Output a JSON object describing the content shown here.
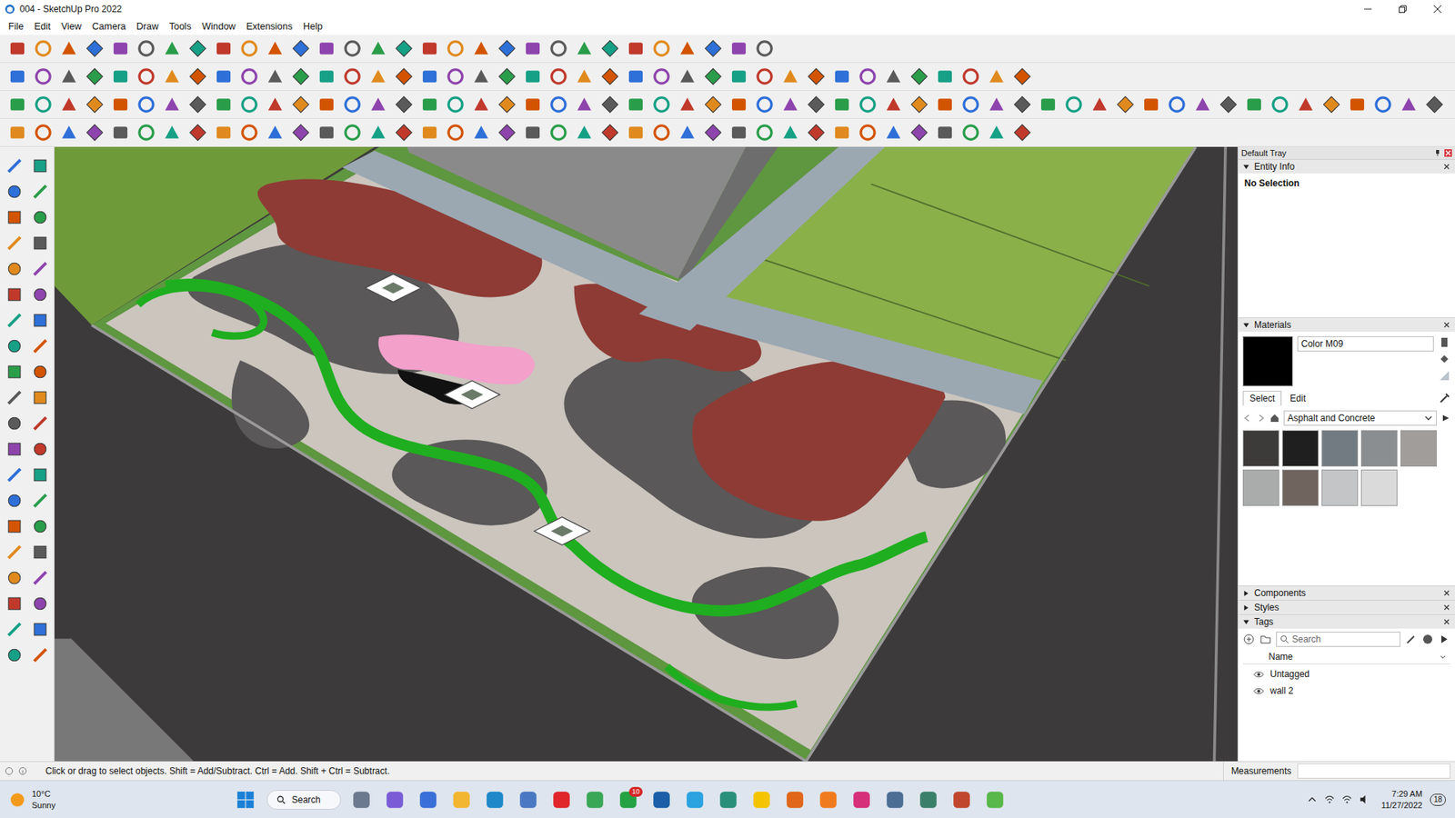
{
  "window": {
    "title": "004 - SketchUp Pro 2022"
  },
  "menu": [
    "File",
    "Edit",
    "View",
    "Camera",
    "Draw",
    "Tools",
    "Window",
    "Extensions",
    "Help"
  ],
  "tray": {
    "title": "Default Tray",
    "entity_info": {
      "title": "Entity Info",
      "expanded": true,
      "text": "No Selection"
    },
    "materials": {
      "title": "Materials",
      "expanded": true,
      "name": "Color M09",
      "color": "#000000",
      "tabs": [
        {
          "label": "Select",
          "selected": true
        },
        {
          "label": "Edit",
          "selected": false
        }
      ],
      "library": "Asphalt and Concrete",
      "swatches": [
        {
          "color": "#3d3a3a"
        },
        {
          "color": "#1f1f1f"
        },
        {
          "color": "#737b82"
        },
        {
          "color": "#8b8e90"
        },
        {
          "color": "#a19d9b"
        },
        {
          "color": "#a9acab"
        },
        {
          "color": "#6f655e"
        },
        {
          "color": "#c3c5c7"
        },
        {
          "color": "#dadada"
        }
      ]
    },
    "collapsed": [
      {
        "title": "Components",
        "expanded": false
      },
      {
        "title": "Styles",
        "expanded": false
      }
    ],
    "tags": {
      "title": "Tags",
      "expanded": true,
      "search_placeholder": "Search",
      "column": "Name",
      "items": [
        {
          "name": "Untagged",
          "visible": true
        },
        {
          "name": "wall 2",
          "visible": true
        }
      ]
    }
  },
  "status_bar": {
    "hint": "Click or drag to select objects. Shift = Add/Subtract. Ctrl = Add. Shift + Ctrl = Subtract.",
    "measurements_label": "Measurements",
    "measurements_value": ""
  },
  "taskbar": {
    "weather": {
      "temp": "10°C",
      "condition": "Sunny"
    },
    "search": "Search",
    "apps": [
      {
        "color": "#6b7a8f",
        "badge": ""
      },
      {
        "color": "#7b5cd6",
        "badge": ""
      },
      {
        "color": "#3a6fd8",
        "badge": ""
      },
      {
        "color": "#f2b632",
        "badge": ""
      },
      {
        "color": "#1e88c9",
        "badge": ""
      },
      {
        "color": "#4a78c2",
        "badge": ""
      },
      {
        "color": "#e0262b",
        "badge": ""
      },
      {
        "color": "#3aa757",
        "badge": ""
      },
      {
        "color": "#25a244",
        "badge": "10"
      },
      {
        "color": "#1c5fa8",
        "badge": ""
      },
      {
        "color": "#2aa3e0",
        "badge": ""
      },
      {
        "color": "#2a8f7a",
        "badge": ""
      },
      {
        "color": "#f5c400",
        "badge": ""
      },
      {
        "color": "#e0661a",
        "badge": ""
      },
      {
        "color": "#f07b1e",
        "badge": ""
      },
      {
        "color": "#d6307a",
        "badge": ""
      },
      {
        "color": "#4d6e94",
        "badge": ""
      },
      {
        "color": "#3a7f6a",
        "badge": ""
      },
      {
        "color": "#c0472d",
        "badge": ""
      },
      {
        "color": "#58b84a",
        "badge": ""
      }
    ],
    "time": "7:29 AM",
    "date": "11/27/2022",
    "notifications": "18"
  }
}
